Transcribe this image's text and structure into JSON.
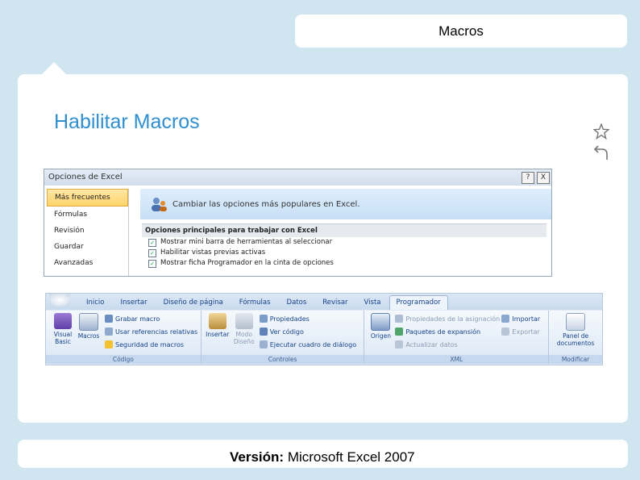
{
  "header": {
    "title": "Macros"
  },
  "slide": {
    "heading": "Habilitar Macros"
  },
  "icons": {
    "star": "star-outline-icon",
    "back": "back-arrow-icon"
  },
  "dialog": {
    "title": "Opciones de Excel",
    "buttons": [
      "?",
      "X"
    ],
    "sidebar": [
      "Más frecuentes",
      "Fórmulas",
      "Revisión",
      "Guardar",
      "Avanzadas"
    ],
    "banner": "Cambiar las opciones más populares en Excel.",
    "section": "Opciones principales para trabajar con Excel",
    "options": [
      "Mostrar mini barra de herramientas al seleccionar",
      "Habilitar vistas previas activas",
      "Mostrar ficha Programador en la cinta de opciones"
    ]
  },
  "ribbon": {
    "tabs": [
      "Inicio",
      "Insertar",
      "Diseño de página",
      "Fórmulas",
      "Datos",
      "Revisar",
      "Vista",
      "Programador"
    ],
    "groups": {
      "codigo": {
        "label": "Código",
        "vb": "Visual Basic",
        "macros": "Macros",
        "items": [
          "Grabar macro",
          "Usar referencias relativas",
          "Seguridad de macros"
        ]
      },
      "controles": {
        "label": "Controles",
        "insertar": "Insertar",
        "modo": "Modo Diseño",
        "items": [
          "Propiedades",
          "Ver código",
          "Ejecutar cuadro de diálogo"
        ]
      },
      "xml": {
        "label": "XML",
        "origen": "Origen",
        "items": [
          "Propiedades de la asignación",
          "Paquetes de expansión",
          "Actualizar datos"
        ],
        "items2": [
          "Importar",
          "Exportar"
        ]
      },
      "modificar": {
        "label": "Modificar",
        "panel": "Panel de documentos"
      }
    }
  },
  "footer": {
    "label": "Versión:",
    "value": " Microsoft Excel 2007"
  }
}
